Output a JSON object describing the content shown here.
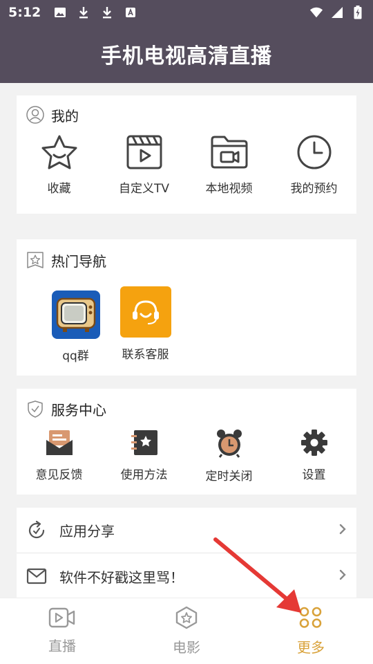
{
  "status": {
    "time": "5:12"
  },
  "header": {
    "title": "手机电视高清直播"
  },
  "mine": {
    "title": "我的",
    "items": [
      {
        "label": "收藏",
        "icon": "star-icon"
      },
      {
        "label": "自定义TV",
        "icon": "clapper-play-icon"
      },
      {
        "label": "本地视频",
        "icon": "folder-video-icon"
      },
      {
        "label": "我的预约",
        "icon": "clock-icon"
      }
    ]
  },
  "hot": {
    "title": "热门导航",
    "items": [
      {
        "label": "qq群",
        "icon": "tv-icon"
      },
      {
        "label": "联系客服",
        "icon": "headset-icon"
      }
    ]
  },
  "service": {
    "title": "服务中心",
    "items": [
      {
        "label": "意见反馈",
        "icon": "feedback-icon"
      },
      {
        "label": "使用方法",
        "icon": "notebook-icon"
      },
      {
        "label": "定时关闭",
        "icon": "alarm-clock-icon"
      },
      {
        "label": "设置",
        "icon": "gear-icon"
      }
    ]
  },
  "list": [
    {
      "label": "应用分享",
      "icon": "share-refresh-icon"
    },
    {
      "label": "软件不好戳这里骂！",
      "icon": "mail-icon"
    }
  ],
  "nav": [
    {
      "label": "直播",
      "icon": "live-video-icon",
      "active": false
    },
    {
      "label": "电影",
      "icon": "movie-hex-icon",
      "active": false
    },
    {
      "label": "更多",
      "icon": "more-grid-icon",
      "active": true
    }
  ],
  "colors": {
    "header_bg": "#554d5d",
    "accent": "#d9a23a",
    "annotation_arrow": "#e53935"
  }
}
